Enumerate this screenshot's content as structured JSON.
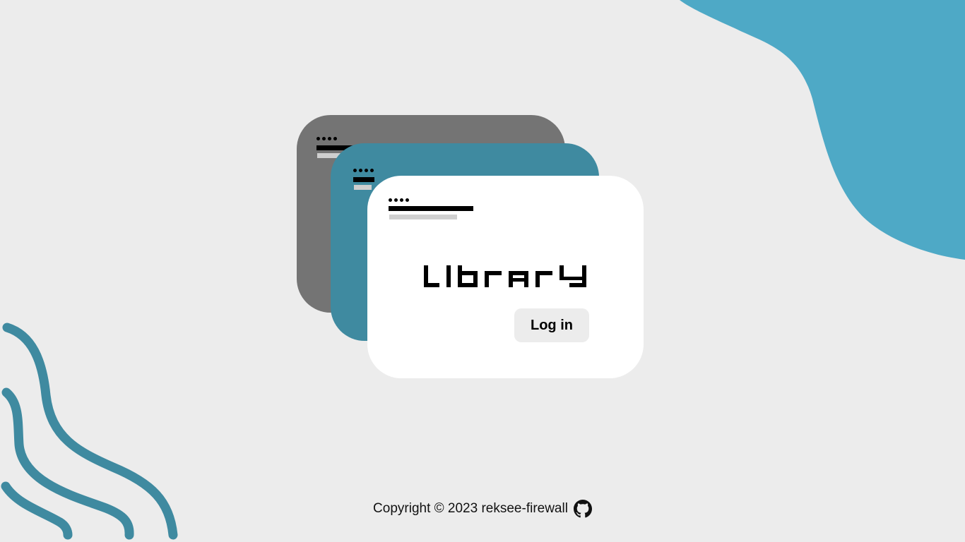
{
  "app": {
    "logo_text": "library"
  },
  "login": {
    "button_label": "Log in"
  },
  "footer": {
    "copyright": "Copyright © 2023 reksee-firewall",
    "github_icon": "github-icon"
  },
  "colors": {
    "background": "#ececec",
    "blob": "#4ea9c6",
    "card_back": "#747474",
    "card_mid": "#3f8aa0",
    "card_front": "#ffffff",
    "waves": "#3f8aa0",
    "button_bg": "#ececec"
  }
}
